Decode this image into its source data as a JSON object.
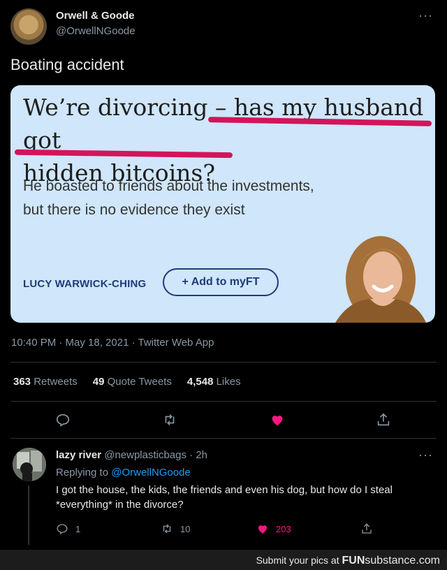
{
  "tweet": {
    "author_name": "Orwell & Goode",
    "author_handle": "@OrwellNGoode",
    "more": "···",
    "text": "Boating accident",
    "timestamp": "10:40 PM · May 18, 2021 · Twitter Web App"
  },
  "card": {
    "headline_line1_a": "We’re divorcing – ",
    "headline_line1_b": "has my husband got",
    "headline_line2": "hidden bitcoins?",
    "standfirst": "He boasted to friends about the investments, but there is no evidence they exist",
    "byline": "LUCY WARWICK-CHING",
    "myft_label": "+ Add to myFT"
  },
  "stats": {
    "retweets_count": "363",
    "retweets_label": "Retweets",
    "quotes_count": "49",
    "quotes_label": "Quote Tweets",
    "likes_count": "4,548",
    "likes_label": "Likes"
  },
  "actions": {
    "icons": [
      "reply-icon",
      "retweet-icon",
      "like-icon",
      "share-icon"
    ],
    "like_color": "#f91880"
  },
  "reply": {
    "name": "lazy river",
    "handle_time": "@newplasticbags · 2h",
    "more": "···",
    "replying_prefix": "Replying to ",
    "replying_handle": "@OrwellNGoode",
    "text": "I got the house, the kids, the friends and even his dog, but how do I steal *everything* in the divorce?",
    "reply_count": "1",
    "retweet_count": "10",
    "like_count": "203"
  },
  "footer": {
    "prefix": "Submit your pics at ",
    "brand_a": "FUN",
    "brand_b": "substance",
    "brand_c": ".com"
  },
  "colors": {
    "background": "#000000",
    "card_bg": "#cfe6fb",
    "highlight": "#d4145a",
    "link": "#1d9bf0"
  }
}
